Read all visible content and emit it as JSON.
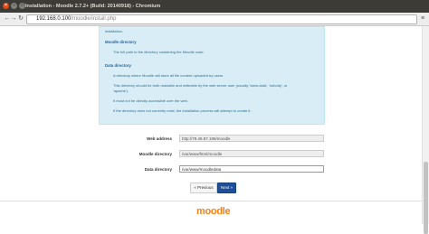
{
  "window": {
    "title": "Installation - Moodle 2.7.2+ (Build: 20140918) - Chromium"
  },
  "toolbar": {
    "url_host": "192.168.0.100",
    "url_path": "/moodle/install.php"
  },
  "info": {
    "installation_trail": "installation.",
    "moodle_directory_heading": "Moodle directory",
    "moodle_directory_text": "The full path to the directory containing the Moodle code.",
    "data_directory_heading": "Data directory",
    "data_directory_line1": "A directory where Moodle will store all file content uploaded by users.",
    "data_directory_line2": "This directory should be both readable and writeable by the web server user (usually 'www-data', 'nobody', or",
    "data_directory_line3": "'apache').",
    "data_directory_line4": "It must not be directly accessible over the web.",
    "data_directory_line5": "If the directory does not currently exist, the installation process will attempt to create it."
  },
  "form": {
    "web_address_label": "Web address",
    "web_address_value": "http://78.46.87.196/moodle",
    "moodle_directory_label": "Moodle directory",
    "moodle_directory_value": "/var/www/html/moodle",
    "data_directory_label": "Data directory",
    "data_directory_value": "/var/www/moodledata"
  },
  "buttons": {
    "previous": "« Previous",
    "next": "Next »"
  },
  "footer": {
    "logo_text": "moodle"
  }
}
